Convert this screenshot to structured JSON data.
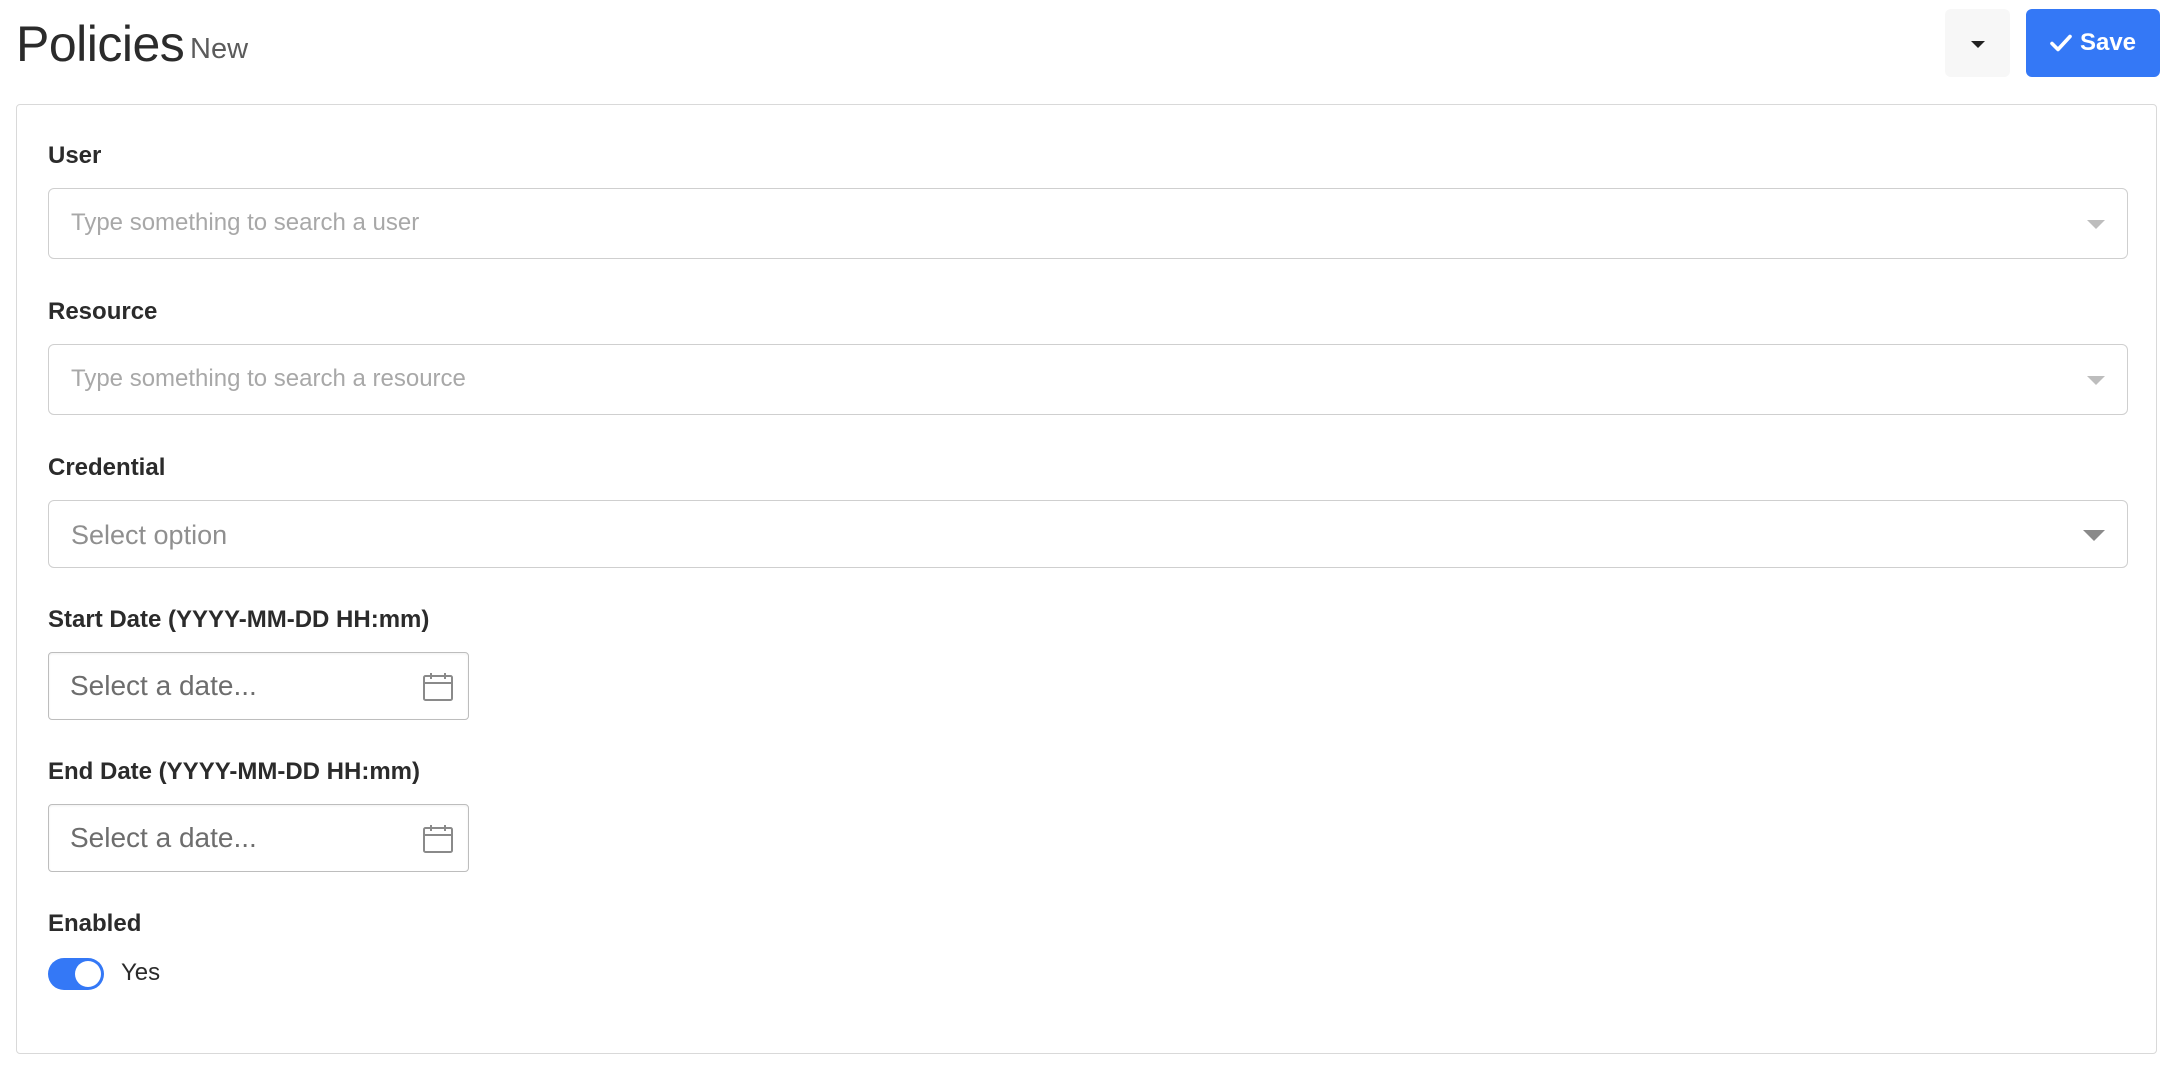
{
  "header": {
    "title": "Policies",
    "subtitle": "New",
    "save_label": "Save",
    "accent_color": "#3478f6"
  },
  "form": {
    "user": {
      "label": "User",
      "placeholder": "Type something to search a user"
    },
    "resource": {
      "label": "Resource",
      "placeholder": "Type something to search a resource"
    },
    "credential": {
      "label": "Credential",
      "placeholder": "Select option"
    },
    "start_date": {
      "label": "Start Date (YYYY-MM-DD HH:mm)",
      "placeholder": "Select a date..."
    },
    "end_date": {
      "label": "End Date (YYYY-MM-DD HH:mm)",
      "placeholder": "Select a date..."
    },
    "enabled": {
      "label": "Enabled",
      "value_label": "Yes",
      "checked": true
    }
  },
  "icons": {
    "dropdown": "caret-down-icon",
    "save": "check-icon",
    "select_arrow": "chevron-down-icon",
    "calendar": "calendar-icon"
  }
}
